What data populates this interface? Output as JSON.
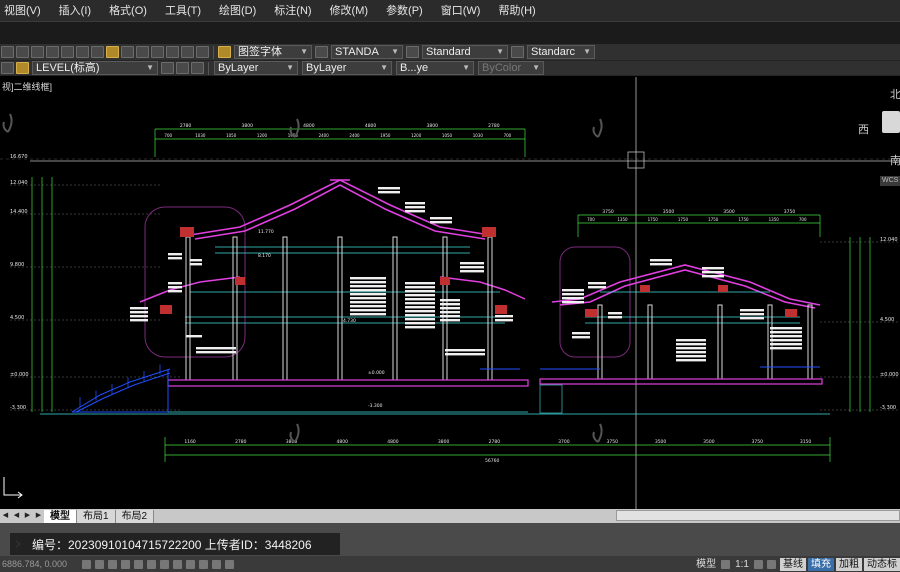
{
  "menu": {
    "items": [
      "视图(V)",
      "插入(I)",
      "格式(O)",
      "工具(T)",
      "绘图(D)",
      "标注(N)",
      "修改(M)",
      "参数(P)",
      "窗口(W)",
      "帮助(H)"
    ]
  },
  "toolbar1": {
    "text_style_label": "图签字体",
    "dim_style": "STANDA",
    "table_style": "Standard",
    "multileader_style": "Standarc"
  },
  "toolbar2": {
    "layer": "LEVEL(标高)",
    "color": "ByLayer",
    "linetype": "ByLayer",
    "lineweight": "B...ye",
    "plotstyle": "ByColor"
  },
  "canvas": {
    "view_label": "视]二维线框]",
    "viewcube": {
      "north": "北",
      "west": "西",
      "south": "南",
      "wcs": "WCS"
    }
  },
  "drawing": {
    "dims_top_left": [
      "2780",
      "3800",
      "4800",
      "4800",
      "3800",
      "2780"
    ],
    "dims_top_left_sub": [
      "700",
      "1030",
      "1050",
      "1200",
      "1950",
      "2400",
      "2400",
      "1950",
      "1200",
      "1050",
      "1030",
      "700"
    ],
    "dims_top_right": [
      "3750",
      "3500",
      "3500",
      "3750"
    ],
    "dims_top_right_sub": [
      "700",
      "1350",
      "1750",
      "1750",
      "1750",
      "1750",
      "1350",
      "700"
    ],
    "elev_left": [
      "16.670",
      "12.040",
      "14.400",
      "9.800",
      "4.500",
      "±0.000",
      "-3.300"
    ],
    "elev_right": [
      "12.040",
      "4.500",
      "±0.000",
      "-3.300"
    ],
    "level_marks": [
      "±0.000",
      "-3.300",
      "4.730",
      "8.170",
      "11.770"
    ],
    "dims_bottom_left": [
      "1160",
      "2780",
      "3800",
      "4800",
      "4800",
      "3800",
      "2780"
    ],
    "dims_bottom_right": [
      "3700",
      "3750",
      "3500",
      "3500",
      "3750",
      "3150"
    ],
    "total_dim": "56760"
  },
  "tabs": {
    "items": [
      {
        "label": "模型",
        "active": true
      },
      {
        "label": "布局1",
        "active": false
      },
      {
        "label": "布局2",
        "active": false
      }
    ]
  },
  "command": {
    "text": "编号：20230910104715722200   上传者ID：3448206"
  },
  "status": {
    "coords": "6886.784, 0.000",
    "model_label": "模型",
    "scale_label": "1:1",
    "buttons": [
      "基线",
      "填充",
      "加粗",
      "动态标"
    ]
  },
  "colors": {
    "magenta": "#e040e0",
    "cyan": "#40e0e0",
    "green": "#40e040",
    "blue": "#2050ff",
    "yellow": "#e8e040"
  }
}
